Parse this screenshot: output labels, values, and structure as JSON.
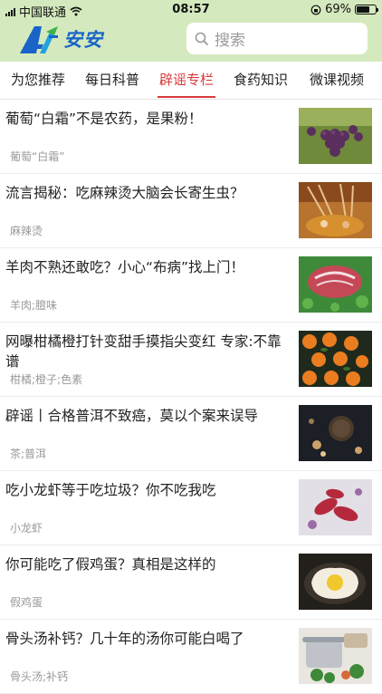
{
  "status_bar": {
    "carrier": "中国联通",
    "time": "08:57",
    "battery_percent": "69%",
    "battery_level": 0.69
  },
  "header": {
    "logo_text": "安安",
    "search_placeholder": "搜索"
  },
  "tabs": [
    {
      "label": "为您推荐"
    },
    {
      "label": "每日科普"
    },
    {
      "label": "辟谣专栏",
      "active": true
    },
    {
      "label": "食药知识"
    },
    {
      "label": "微课视频"
    }
  ],
  "articles": [
    {
      "title": "葡萄“白霜”不是农药，是果粉！",
      "tag": "葡萄“白霜”",
      "image": "grapes"
    },
    {
      "title": "流言揭秘：吃麻辣烫大脑会长寄生虫？",
      "tag": "麻辣烫",
      "image": "hotpot"
    },
    {
      "title": "羊肉不熟还敢吃？小心“布病”找上门！",
      "tag": "羊肉;膻味",
      "image": "lamb"
    },
    {
      "title": "网曝柑橘橙打针变甜手摸指尖变红 专家:不靠谱",
      "tag": "柑橘;橙子;色素",
      "image": "oranges"
    },
    {
      "title": "辟谣丨合格普洱不致癌，莫以个案来误导",
      "tag": "茶;普洱",
      "image": "puer"
    },
    {
      "title": "吃小龙虾等于吃垃圾？你不吃我吃",
      "tag": "小龙虾",
      "image": "crayfish"
    },
    {
      "title": "你可能吃了假鸡蛋？真相是这样的",
      "tag": "假鸡蛋",
      "image": "egg"
    },
    {
      "title": "骨头汤补钙？几十年的汤你可能白喝了",
      "tag": "骨头汤;补钙",
      "image": "soup"
    }
  ]
}
